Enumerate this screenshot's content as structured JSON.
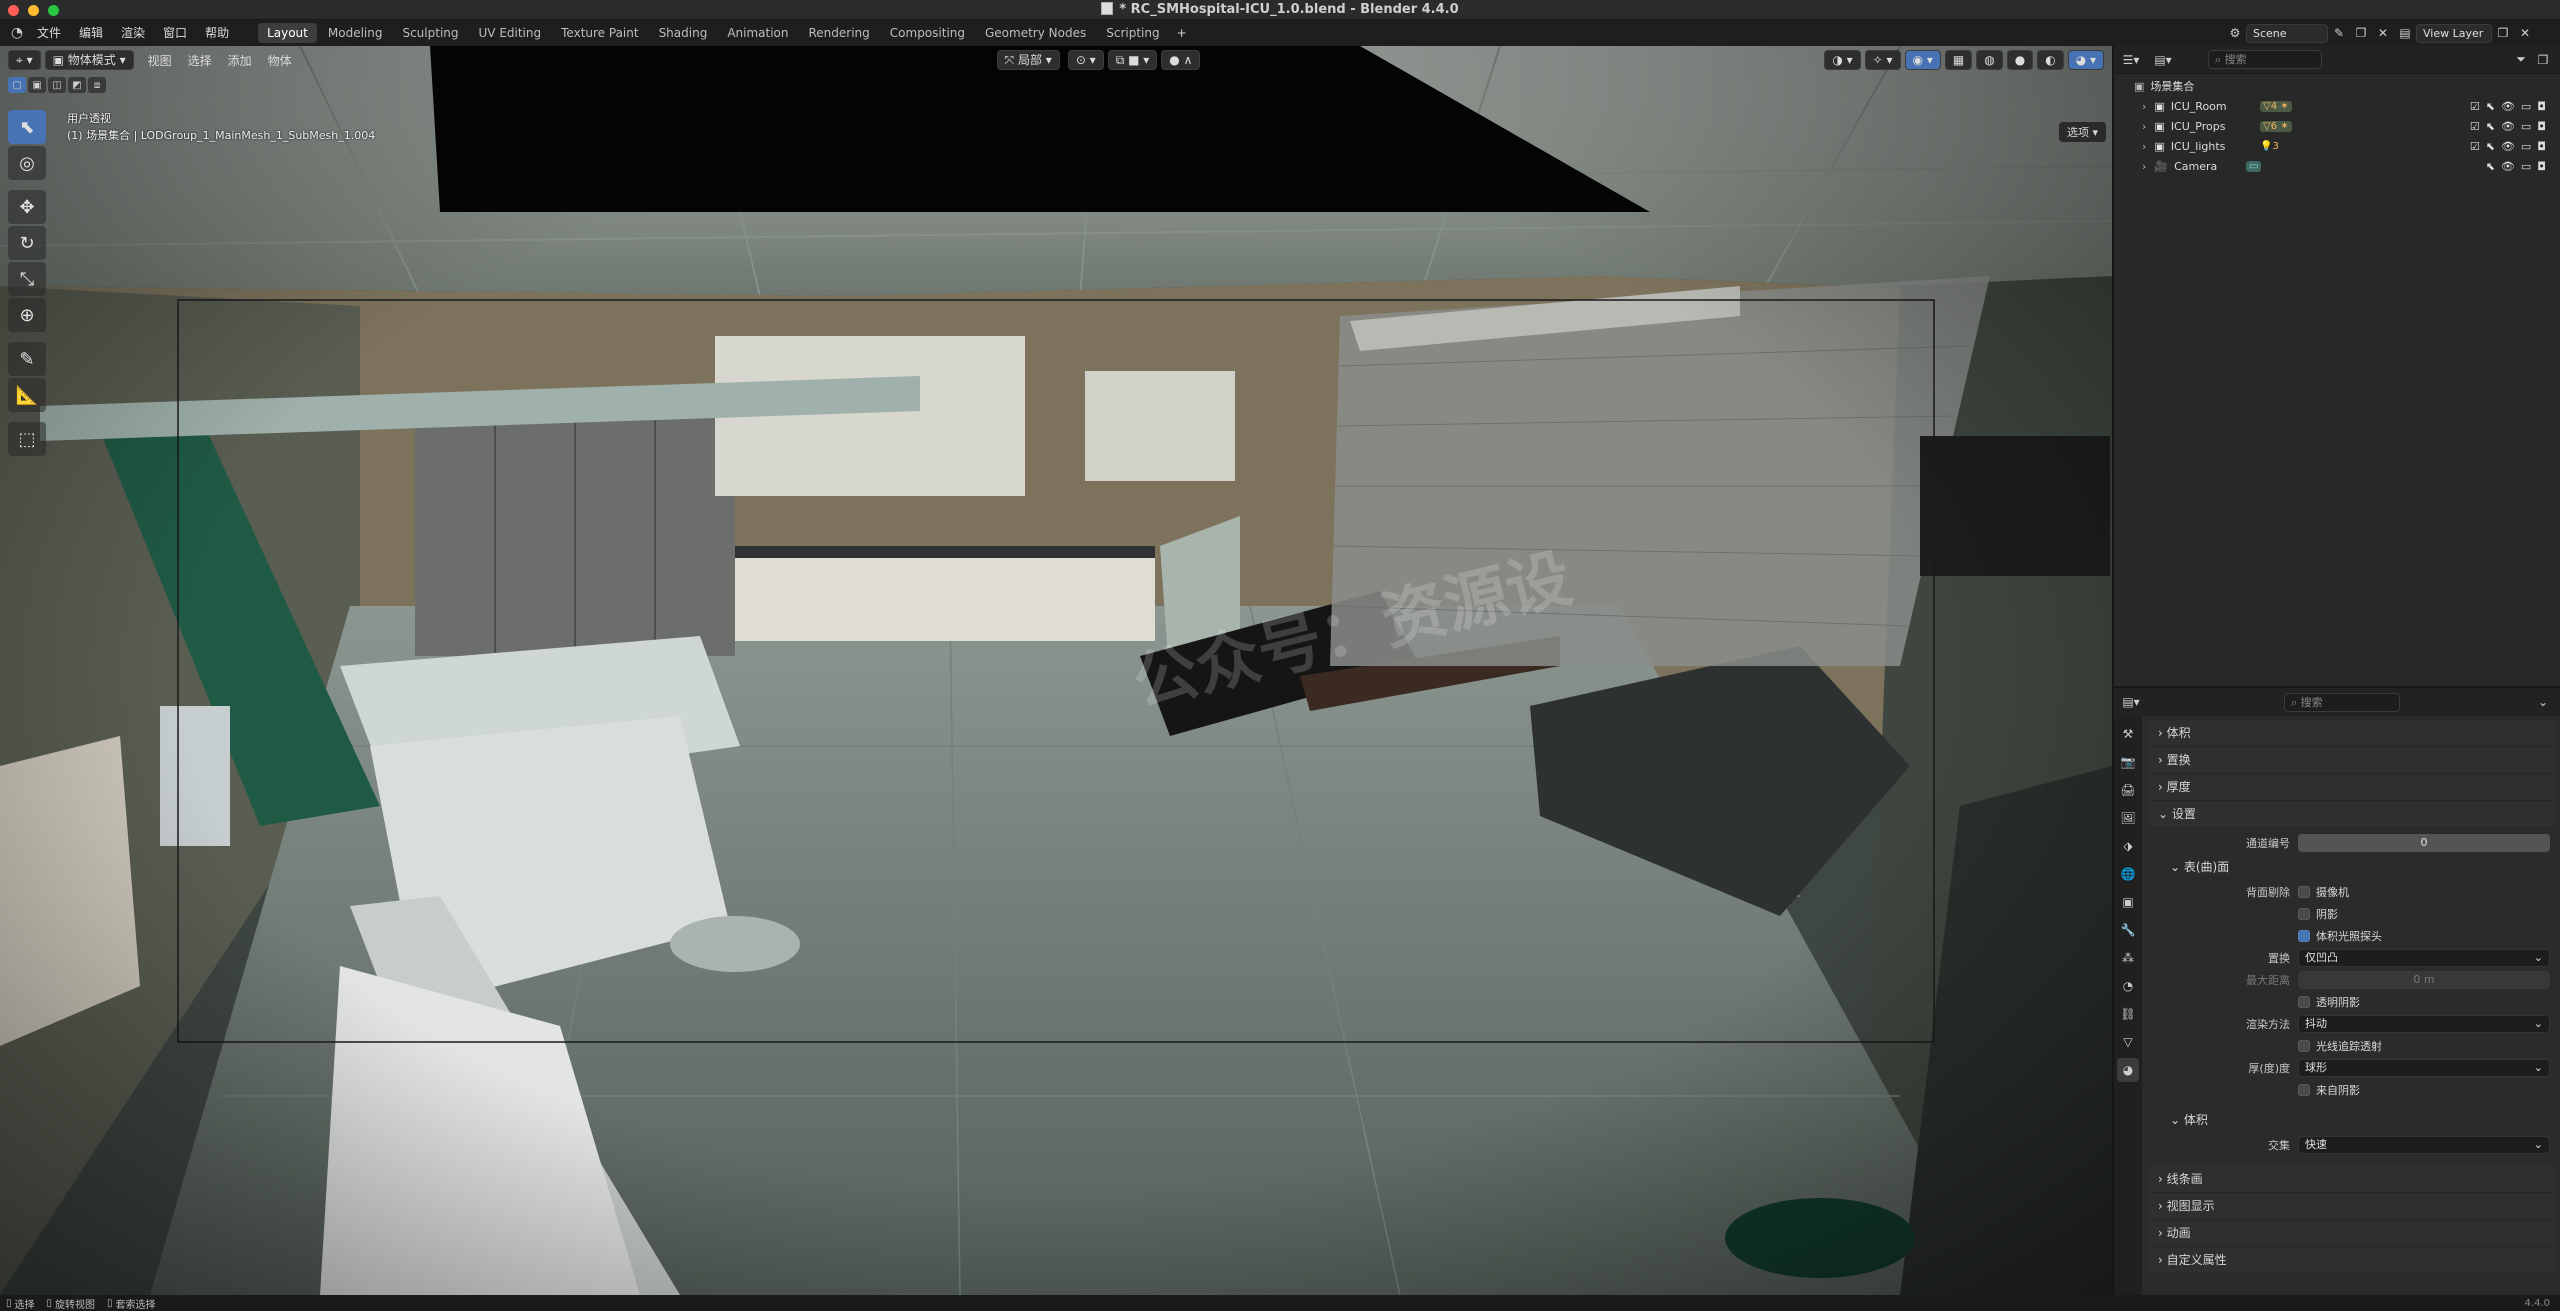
{
  "window": {
    "title": "* RC_SMHospital-ICU_1.0.blend - Blender 4.4.0"
  },
  "menu": [
    "文件",
    "编辑",
    "渲染",
    "窗口",
    "帮助"
  ],
  "workspaces": [
    "Layout",
    "Modeling",
    "Sculpting",
    "UV Editing",
    "Texture Paint",
    "Shading",
    "Animation",
    "Rendering",
    "Compositing",
    "Geometry Nodes",
    "Scripting"
  ],
  "active_workspace": "Layout",
  "topright": {
    "scene": "Scene",
    "view_layer": "View Layer"
  },
  "viewport": {
    "mode": "物体模式",
    "menus": [
      "视图",
      "选择",
      "添加",
      "物体"
    ],
    "transform_orientation": "局部",
    "info_line1": "用户透视",
    "info_line2": "(1) 场景集合 | LODGroup_1_MainMesh_1_SubMesh_1.004",
    "options": "选项",
    "watermark": "公众号：资源设"
  },
  "outliner": {
    "search_placeholder": "搜索",
    "root": "场景集合",
    "items": [
      {
        "name": "ICU_Room",
        "badge": "4"
      },
      {
        "name": "ICU_Props",
        "badge": "6"
      },
      {
        "name": "ICU_lights",
        "badge": "3"
      },
      {
        "name": "Camera",
        "badge": ""
      }
    ]
  },
  "properties": {
    "search_placeholder": "搜索",
    "sections": {
      "volume": "体积",
      "displacement": "置换",
      "thickness": "厚度",
      "settings": "设置",
      "pass_index_label": "通道编号",
      "pass_index_value": "0",
      "surface": "表(曲)面",
      "backface_culling_label": "背面剔除",
      "camera": "摄像机",
      "shadow": "阴影",
      "light_probe_volume": "体积光照探头",
      "displacement_label": "置换",
      "displacement_value": "仅凹凸",
      "max_distance_label": "最大距离",
      "max_distance_value": "0 m",
      "transparent_shadows": "透明阴影",
      "render_method_label": "渲染方法",
      "render_method_value": "抖动",
      "raytraced_transmission": "光线追踪透射",
      "thickness_label": "厚(度)度",
      "thickness_value": "球形",
      "from_shadow": "来自阴影",
      "volume_sub": "体积",
      "intersection_label": "交集",
      "intersection_value": "快速",
      "line_art": "线条画",
      "viewport_display": "视图显示",
      "animation": "动画",
      "custom_properties": "自定义属性"
    }
  },
  "statusbar": {
    "select": "选择",
    "rotate_view": "旋转视图",
    "box_select": "套索选择",
    "version": "4.4.0"
  }
}
